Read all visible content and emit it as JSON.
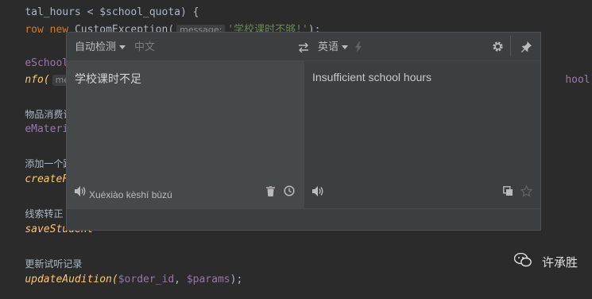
{
  "editor": {
    "lines": [
      {
        "t": "tal_hours < $school_quota) {"
      },
      {
        "a": "row new ",
        "b": "CustomException(",
        "hint": "message:",
        "c": "'学校课时不够!'",
        "d": ");"
      },
      {
        "a": "eSchool = S"
      },
      {
        "a": "nfo(",
        "hint": "message",
        "tail": "hool]);"
      },
      {
        "cmt": "物品消费记录及"
      },
      {
        "a": "eMaterial ="
      },
      {
        "cmt": "添加一个跟进记"
      },
      {
        "fn": "createFollo"
      },
      {
        "cmt": "线索转正"
      },
      {
        "fn": "saveStudent"
      },
      {
        "cmt": "更新试听记录"
      },
      {
        "fn": "updateAudition(",
        "v1": "$order_id",
        "sep": ", ",
        "v2": "$params",
        "end": ");"
      }
    ]
  },
  "translator": {
    "source_lang": "自动检测",
    "detected_lang": "中文",
    "target_lang": "英语",
    "source_text": "学校课时不足",
    "translated_text": "Insufficient school hours",
    "pinyin": "Xuéxiào kèshí bùzú"
  },
  "watermark": {
    "text": "许承胜"
  }
}
